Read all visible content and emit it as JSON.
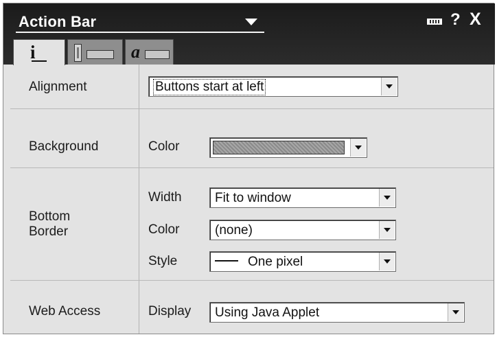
{
  "window": {
    "title": "Action Bar",
    "help_glyph": "?",
    "close_glyph": "X"
  },
  "tabs": [
    {
      "name": "info-tab",
      "icon": "info-icon",
      "glyph": "i",
      "active": true
    },
    {
      "name": "border-tab",
      "icon": "border-icon",
      "active": false
    },
    {
      "name": "text-tab",
      "icon": "font-icon",
      "glyph": "a",
      "active": false
    }
  ],
  "alignment": {
    "label": "Alignment",
    "value": "Buttons start at left"
  },
  "background": {
    "label": "Background",
    "color_label": "Color",
    "color_value": "#999999"
  },
  "bottom_border": {
    "label": "Bottom Border",
    "width_label": "Width",
    "width_value": "Fit to window",
    "color_label": "Color",
    "color_value": "(none)",
    "style_label": "Style",
    "style_value": "One pixel"
  },
  "web_access": {
    "label": "Web Access",
    "display_label": "Display",
    "display_value": "Using Java Applet"
  }
}
